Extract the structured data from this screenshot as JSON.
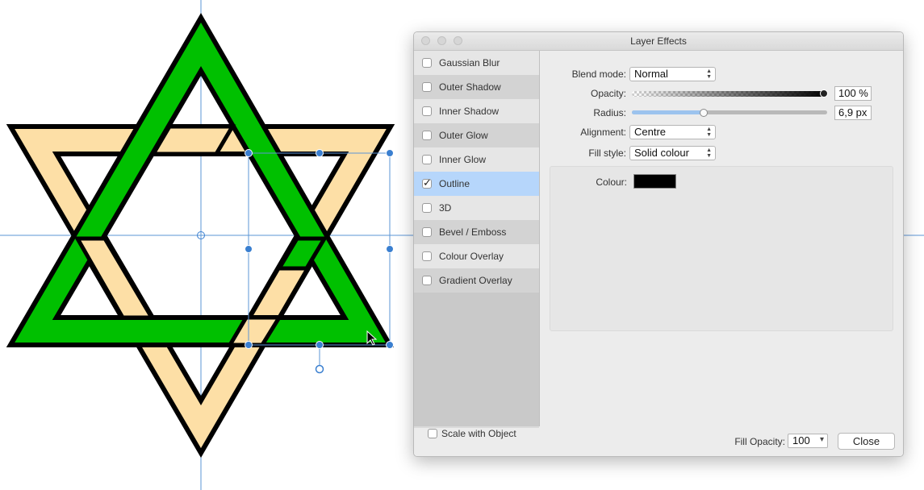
{
  "dialog": {
    "title": "Layer Effects",
    "effects": [
      {
        "label": "Gaussian Blur",
        "checked": false
      },
      {
        "label": "Outer Shadow",
        "checked": false
      },
      {
        "label": "Inner Shadow",
        "checked": false
      },
      {
        "label": "Outer Glow",
        "checked": false
      },
      {
        "label": "Inner Glow",
        "checked": false
      },
      {
        "label": "Outline",
        "checked": true
      },
      {
        "label": "3D",
        "checked": false
      },
      {
        "label": "Bevel / Emboss",
        "checked": false
      },
      {
        "label": "Colour Overlay",
        "checked": false
      },
      {
        "label": "Gradient Overlay",
        "checked": false
      }
    ],
    "check_glyph": "✓",
    "settings": {
      "blend_mode_label": "Blend mode:",
      "blend_mode_value": "Normal",
      "opacity_label": "Opacity:",
      "opacity_value": "100 %",
      "opacity_fraction": 1.0,
      "radius_label": "Radius:",
      "radius_value": "6,9 px",
      "radius_fraction": 0.36,
      "alignment_label": "Alignment:",
      "alignment_value": "Centre",
      "fill_style_label": "Fill style:",
      "fill_style_value": "Solid colour",
      "colour_label": "Colour:",
      "colour_value": "#000000"
    },
    "footer": {
      "scale_with_object_label": "Scale with Object",
      "scale_with_object_checked": false,
      "fill_opacity_label": "Fill Opacity:",
      "fill_opacity_value": "100",
      "close_label": "Close"
    },
    "select_arrows": "▲\n▼",
    "dropdown_arrow": "▾"
  },
  "canvas": {
    "colors": {
      "green": "#00c000",
      "tan": "#fddfa6",
      "outline": "#000000",
      "guide": "#5b95d6",
      "handle": "#3a7fd0"
    }
  }
}
